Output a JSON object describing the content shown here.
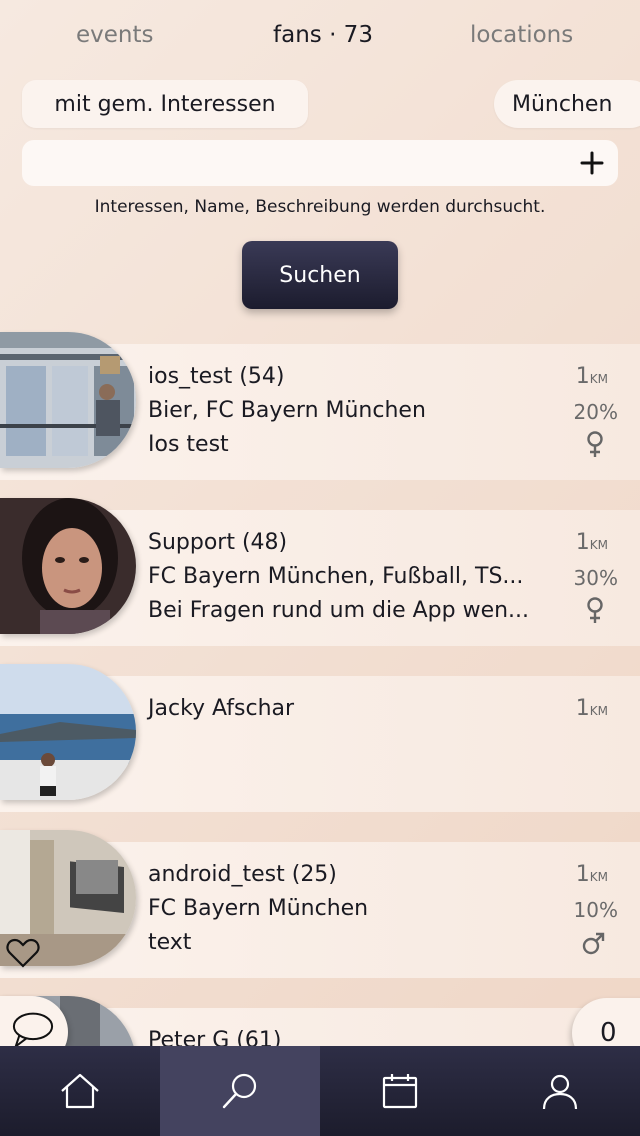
{
  "tabs": {
    "events": "events",
    "fans": "fans · 73",
    "locations": "locations"
  },
  "filters": {
    "interests_label": "mit gem. Interessen",
    "city_label": "München"
  },
  "search": {
    "value": "",
    "placeholder": "",
    "hint": "Interessen, Name, Beschreibung werden durchsucht.",
    "button_label": "Suchen"
  },
  "users": [
    {
      "name": "ios_test (54)",
      "interests": "Bier, FC Bayern München",
      "desc": "Ios test",
      "dist": "1",
      "unit": "KM",
      "match": "20%",
      "gender": "female"
    },
    {
      "name": "Support (48)",
      "interests": "FC Bayern München, Fußball, TS...",
      "desc": "Bei Fragen rund um die App wen...",
      "dist": "1",
      "unit": "KM",
      "match": "30%",
      "gender": "female"
    },
    {
      "name": "Jacky Afschar",
      "interests": "",
      "desc": "",
      "dist": "1",
      "unit": "KM",
      "match": "",
      "gender": ""
    },
    {
      "name": "android_test (25)",
      "interests": "FC Bayern München",
      "desc": "text",
      "dist": "1",
      "unit": "KM",
      "match": "10%",
      "gender": "male"
    },
    {
      "name": "Peter G (61)",
      "interests": "",
      "desc": "",
      "dist": "",
      "unit": "",
      "match": "",
      "gender": ""
    }
  ],
  "chat_counter": "0",
  "nav": [
    "home",
    "search",
    "calendar",
    "profile"
  ],
  "colors": {
    "nav_bg": "#2e2e46",
    "nav_active": "#44435f",
    "button": "#2a2a40"
  }
}
